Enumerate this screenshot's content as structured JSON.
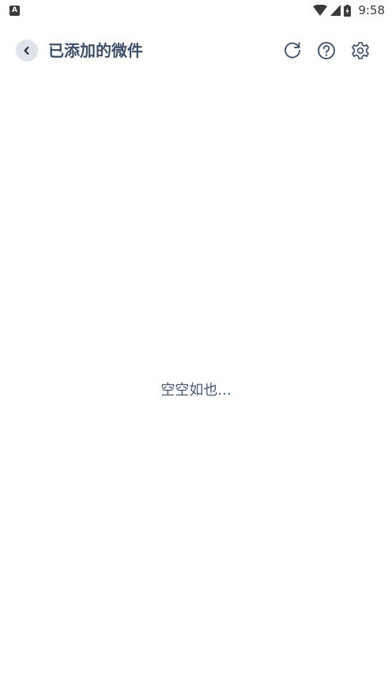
{
  "status_bar": {
    "notification_icon": "A",
    "time": "9:58"
  },
  "header": {
    "title": "已添加的微件",
    "back_icon": "chevron-left-icon",
    "actions": [
      "refresh-icon",
      "help-icon",
      "settings-icon"
    ]
  },
  "content": {
    "empty_text": "空空如也..."
  },
  "colors": {
    "title": "#3f5067",
    "icon": "#4a5a70",
    "back_bg": "#dfe2e8",
    "background": "#ffffff"
  }
}
